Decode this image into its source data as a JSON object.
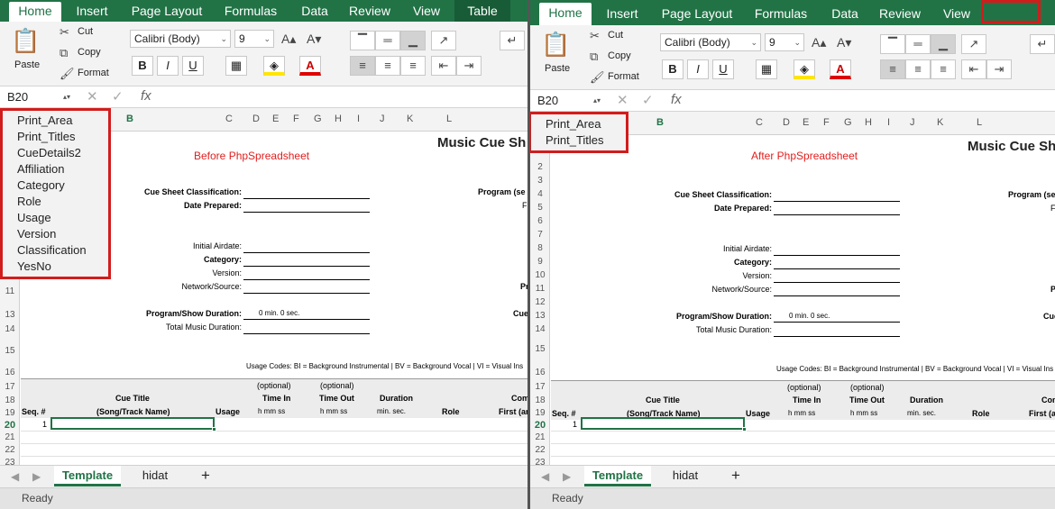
{
  "ribbon": {
    "tabs": [
      "Home",
      "Insert",
      "Page Layout",
      "Formulas",
      "Data",
      "Review",
      "View"
    ],
    "left_extra_tab": "Table",
    "clipboard": {
      "paste": "Paste",
      "cut": "Cut",
      "copy": "Copy",
      "format": "Format"
    },
    "font_name": "Calibri (Body)",
    "font_size": "9",
    "bold": "B",
    "italic": "I",
    "underline": "U"
  },
  "formula_bar": {
    "cell_ref": "B20",
    "fx": "fx"
  },
  "columns_left": [
    "B",
    "C",
    "D",
    "E",
    "F",
    "G",
    "H",
    "I",
    "J",
    "K",
    "L"
  ],
  "columns_right": [
    "B",
    "C",
    "D",
    "E",
    "F",
    "G",
    "H",
    "I",
    "J",
    "K",
    "L"
  ],
  "rows_visible": [
    "1",
    "2",
    "3",
    "4",
    "5",
    "6",
    "7",
    "8",
    "9",
    "10",
    "11",
    "12",
    "13",
    "14",
    "15",
    "16",
    "17",
    "18",
    "19",
    "20",
    "21",
    "22",
    "23"
  ],
  "sheet": {
    "title": "Music Cue Sh",
    "before_label": "Before PhpSpreadsheet",
    "after_label": "After PhpSpreadsheet",
    "cue_sheet_classification": "Cue Sheet Classification:",
    "date_prepared": "Date Prepared:",
    "program_se": "Program (se",
    "initial_airdate": "Initial Airdate:",
    "category": "Category:",
    "version": "Version:",
    "network_source": "Network/Source:",
    "program_show_duration": "Program/Show Duration:",
    "duration_values": "0  min.        0  sec.",
    "total_music_duration": "Total Music Duration:",
    "usage_codes": "Usage Codes:  BI = Background Instrumental | BV = Background Vocal | VI = Visual Ins",
    "optional": "(optional)",
    "time_in": "Time In",
    "time_out": "Time Out",
    "hmmss": "h   mm   ss",
    "duration": "Duration",
    "min_sec": "min.  sec.",
    "seq": "Seq. #",
    "cue_title": "Cue Title",
    "song_track": "(Song/Track Name)",
    "usage": "Usage",
    "role": "Role",
    "com": "Com",
    "first_a": "First (ar",
    "seq1": "1",
    "stub_F": "F",
    "stub_Pr": "Pr",
    "stub_Cue": "Cue",
    "stub_P": "P"
  },
  "named_ranges_before": [
    "Print_Area",
    "Print_Titles",
    "CueDetails2",
    "Affiliation",
    "Category",
    "Role",
    "Usage",
    "Version",
    "Classification",
    "YesNo"
  ],
  "named_ranges_after": [
    "Print_Area",
    "Print_Titles"
  ],
  "sheet_tabs": [
    "Template",
    "hidat"
  ],
  "add_sheet": "+",
  "status": "Ready",
  "colors": {
    "excel_green": "#217346",
    "highlight_red": "#d21c1c",
    "subtitle_red": "#e02020"
  }
}
